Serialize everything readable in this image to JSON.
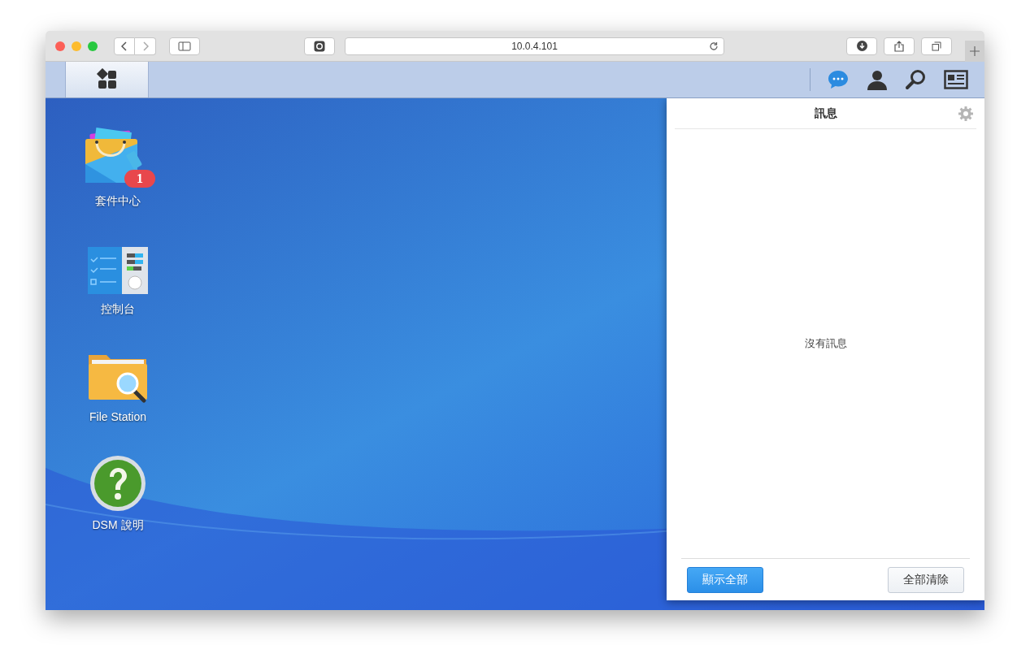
{
  "browser": {
    "url": "10.0.4.101"
  },
  "desktop_icons": [
    {
      "label": "套件中心",
      "kind": "package",
      "badge": "1"
    },
    {
      "label": "控制台",
      "kind": "control"
    },
    {
      "label": "File Station",
      "kind": "folder"
    },
    {
      "label": "DSM 說明",
      "kind": "help"
    }
  ],
  "notifications": {
    "title": "訊息",
    "empty_text": "沒有訊息",
    "buttons": [
      {
        "label": "顯示全部",
        "kind": "primary"
      },
      {
        "label": "全部清除",
        "kind": "secondary"
      }
    ]
  }
}
